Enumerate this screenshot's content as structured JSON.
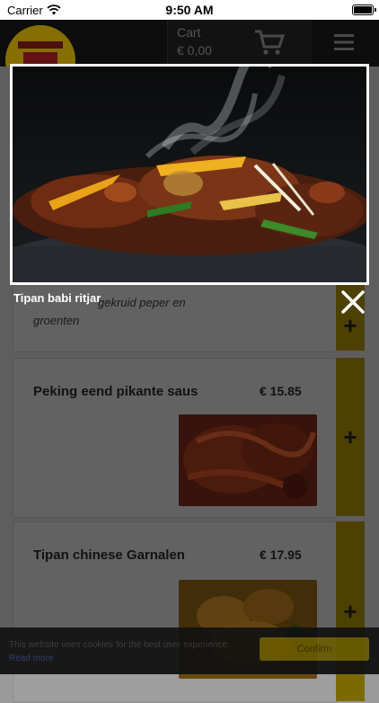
{
  "statusbar": {
    "carrier": "Carrier",
    "time": "9:50 AM"
  },
  "header": {
    "cart_label": "Cart",
    "cart_amount": "€ 0,00"
  },
  "modal": {
    "title": "Tipan babi ritjar"
  },
  "dishes": [
    {
      "name": "",
      "price": "",
      "desc": "gekruid peper en groenten",
      "add": "+"
    },
    {
      "name": "Peking eend pikante saus",
      "price": "€ 15.85",
      "add": "+"
    },
    {
      "name": "Tipan chinese Garnalen",
      "price": "€ 17.95",
      "add": "+"
    }
  ],
  "cookie": {
    "text": "This website uses cookies for the best user experience.",
    "link": "Read more",
    "button": "Confirm"
  },
  "icons": [
    "wifi-icon",
    "battery-icon",
    "cart-icon",
    "menu-icon",
    "close-icon",
    "plus-icon"
  ]
}
